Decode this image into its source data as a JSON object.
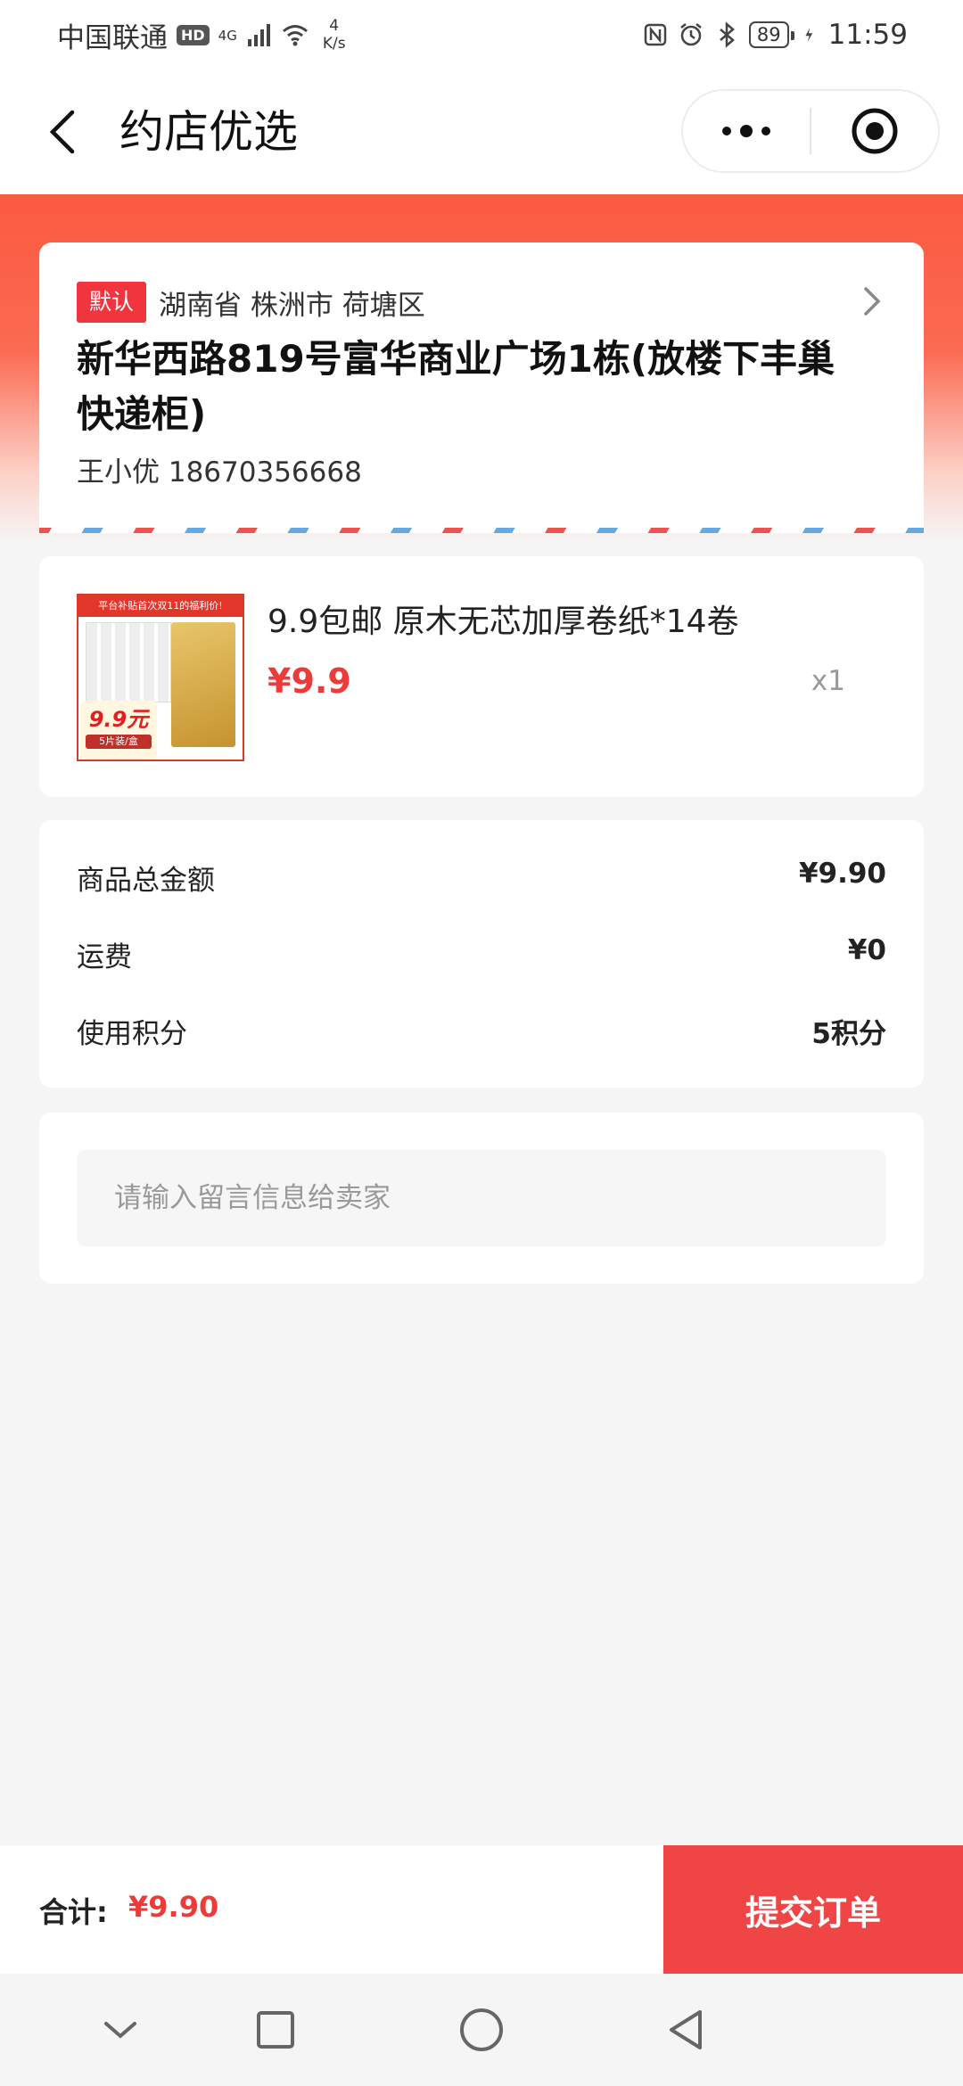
{
  "status_bar": {
    "carrier": "中国联通",
    "hd": "HD",
    "network": "4G",
    "speed_value": "4",
    "speed_unit": "K/s",
    "battery": "89",
    "time": "11:59"
  },
  "nav": {
    "title": "约店优选"
  },
  "address": {
    "default_badge": "默认",
    "region": "湖南省 株洲市 荷塘区",
    "detail": "新华西路819号富华商业广场1栋(放楼下丰巢快递柜)",
    "contact": "王小优  18670356668"
  },
  "product": {
    "thumb_top": "平台补贴首次双11的福利价!",
    "thumb_price": "9.9元",
    "thumb_pack": "5片装/盒",
    "title": "9.9包邮 原木无芯加厚卷纸*14卷",
    "price": "¥9.9",
    "quantity": "x1"
  },
  "summary": {
    "rows": [
      {
        "label": "商品总金额",
        "value": "¥9.90"
      },
      {
        "label": "运费",
        "value": "¥0"
      },
      {
        "label": "使用积分",
        "value": "5积分"
      }
    ]
  },
  "message": {
    "placeholder": "请输入留言信息给卖家"
  },
  "footer": {
    "total_label": "合计:",
    "total_value": "¥9.90",
    "submit_label": "提交订单"
  },
  "colors": {
    "brand_red": "#f04545",
    "price_red": "#ef3a3a",
    "header_gradient_top": "#fb5a41"
  }
}
